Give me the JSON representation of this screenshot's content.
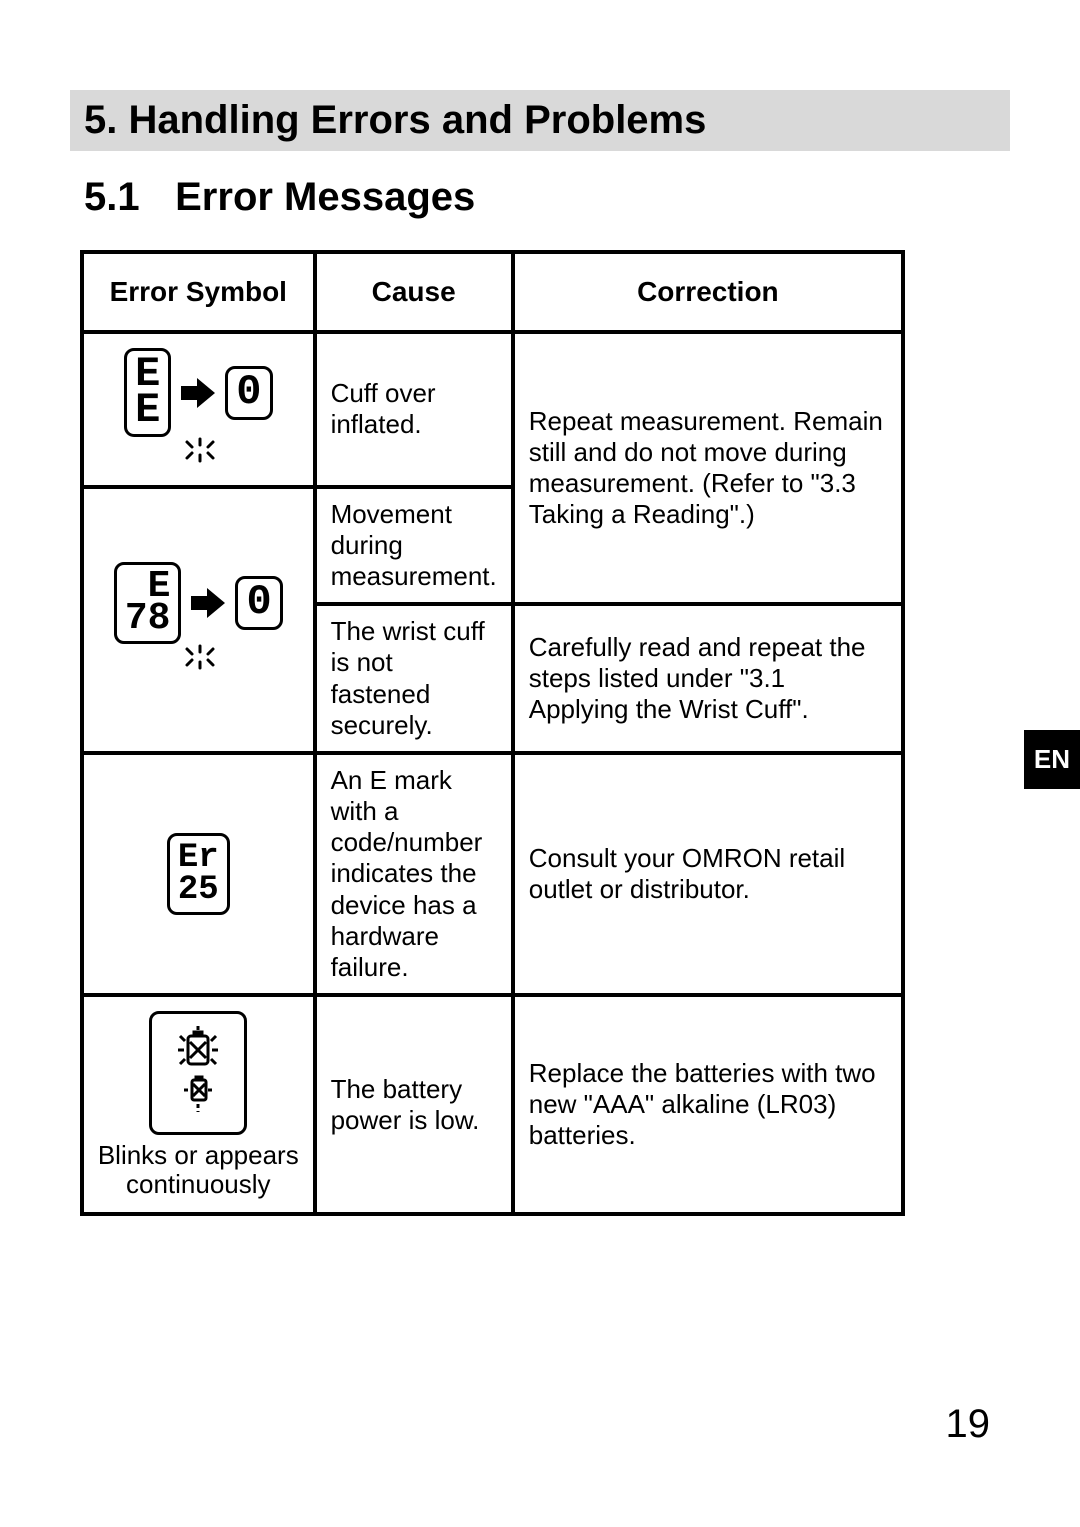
{
  "section_title": "5.  Handling Errors and Problems",
  "subsection_number": "5.1",
  "subsection_title": "Error Messages",
  "table": {
    "headers": {
      "symbol": "Error Symbol",
      "cause": "Cause",
      "correction": "Correction"
    },
    "rows": {
      "r1": {
        "lcd_text_a": "E\nE",
        "lcd_text_b": "0",
        "cause": "Cuff over inflated.",
        "correction_merged": "Repeat measurement. Remain still and do not move during measurement. (Refer to \"3.3 Taking a Reading\".)"
      },
      "r2": {
        "lcd_text_a": "E\n78",
        "lcd_text_b": "0",
        "cause": "Movement during measurement."
      },
      "r3": {
        "cause": "The wrist cuff is not fastened securely.",
        "correction": "Carefully read and repeat the steps listed under \"3.1 Applying the Wrist Cuff\"."
      },
      "r4": {
        "lcd_text": "Er\n25",
        "cause": "An E mark with a code/number indicates the device has a hardware failure.",
        "correction": "Consult your OMRON retail outlet or distributor."
      },
      "r5": {
        "caption": "Blinks or appears\ncontinuously",
        "cause": "The battery power is low.",
        "correction": "Replace the batteries with two new \"AAA\" alkaline (LR03) batteries."
      }
    }
  },
  "lang_tab": "EN",
  "page_number": "19"
}
